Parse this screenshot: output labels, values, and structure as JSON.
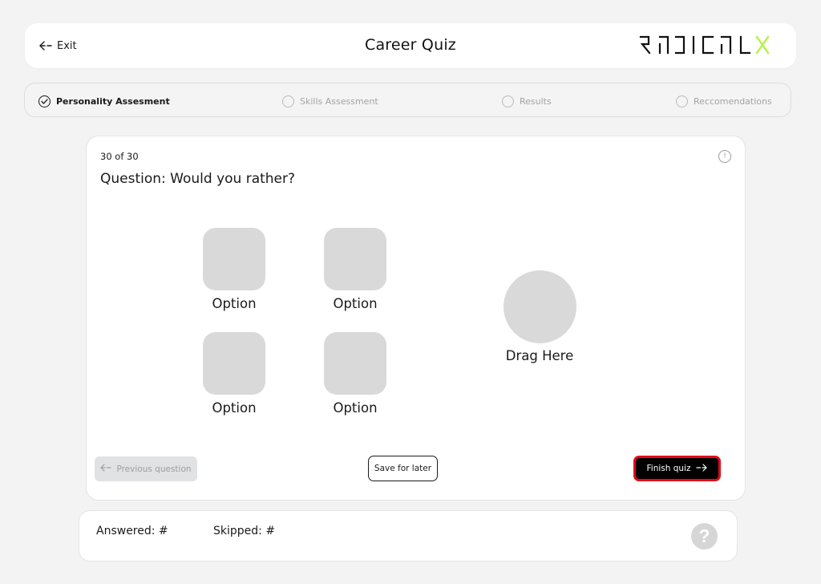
{
  "header": {
    "exit_label": "Exit",
    "title": "Career Quiz",
    "brand": {
      "text": "RADICALX",
      "accent_color": "#b6f24a"
    }
  },
  "stepper": {
    "steps": [
      {
        "label": "Personality Assesment",
        "state": "completed"
      },
      {
        "label": "Skills Assessment",
        "state": "pending"
      },
      {
        "label": "Results",
        "state": "pending"
      },
      {
        "label": "Reccomendations",
        "state": "pending"
      }
    ]
  },
  "question_card": {
    "counter": "30 of 30",
    "question": "Question: Would you rather?",
    "options": [
      {
        "label": "Option"
      },
      {
        "label": "Option"
      },
      {
        "label": "Option"
      },
      {
        "label": "Option"
      }
    ],
    "dropzone_label": "Drag Here",
    "prev_label": "Previous question",
    "save_label": "Save for later",
    "finish_label": "Finish quiz",
    "info_icon": "info-icon"
  },
  "footer": {
    "answered_label": "Answered: #",
    "skipped_label": "Skipped: #",
    "help_icon": "question-mark-icon"
  },
  "colors": {
    "background": "#f3f3f3",
    "finish_border": "#e30b17",
    "tile": "#d9d9d9"
  }
}
